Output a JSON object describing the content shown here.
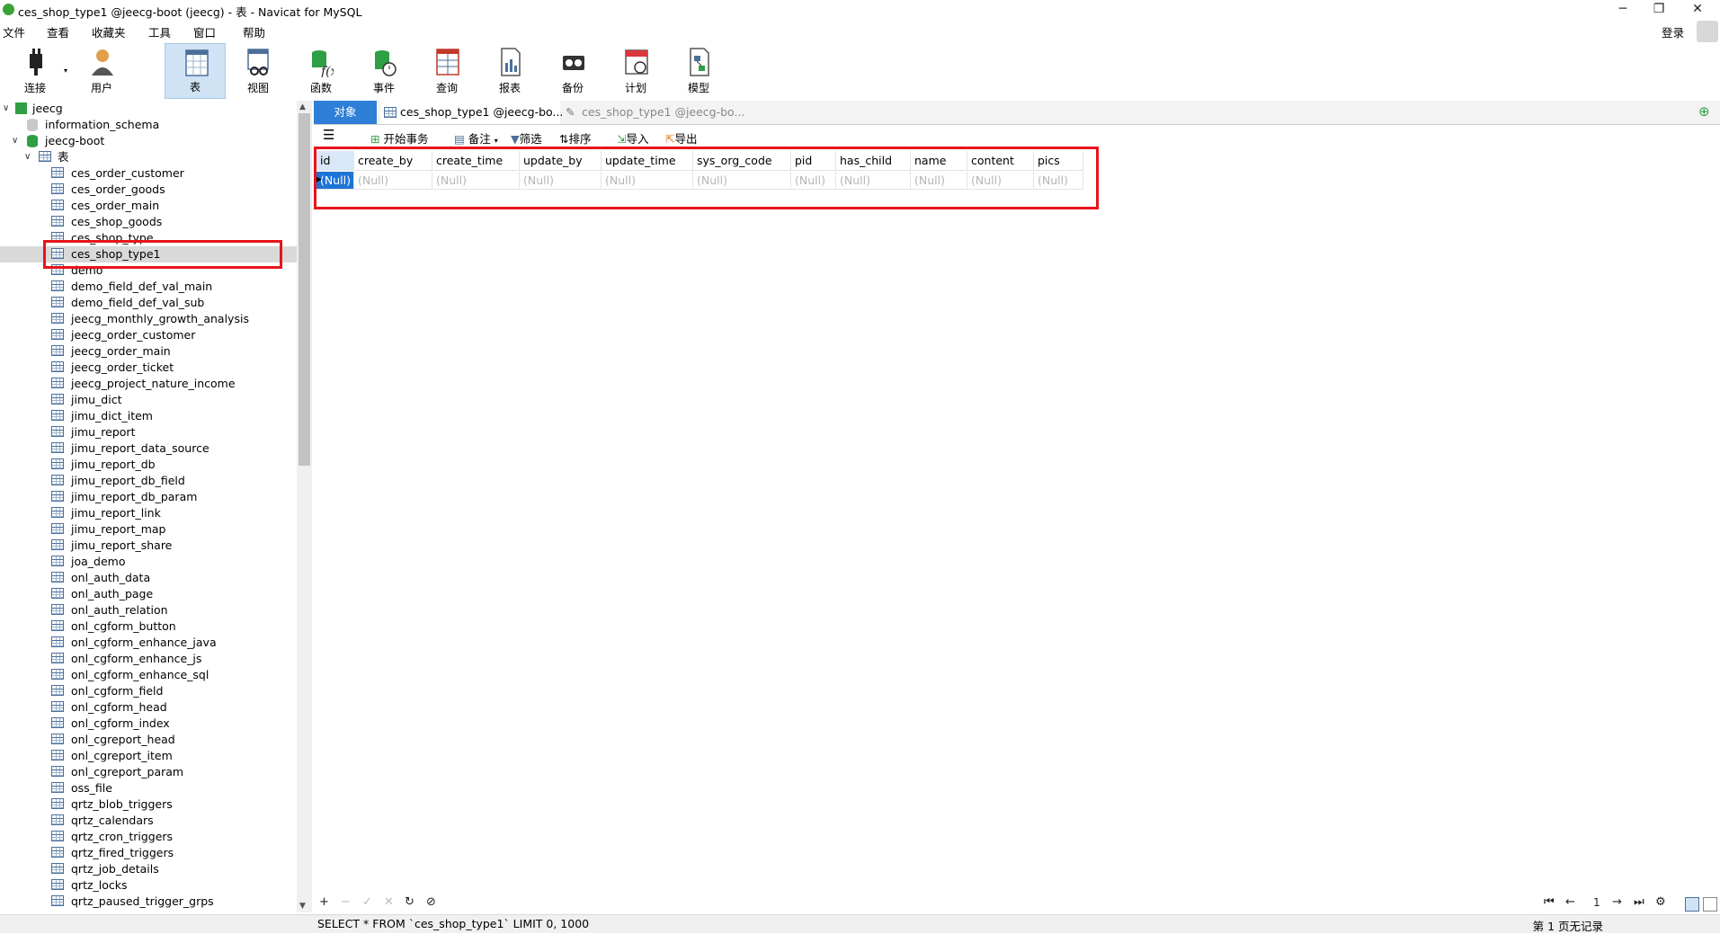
{
  "window": {
    "title": "ces_shop_type1 @jeecg-boot (jeecg) - 表 - Navicat for MySQL",
    "min": "─",
    "max": "❐",
    "close": "✕"
  },
  "menu": [
    "文件",
    "查看",
    "收藏夹",
    "工具",
    "窗口",
    "帮助"
  ],
  "login_label": "登录",
  "toolbar": [
    {
      "label": "连接",
      "icon": "plug-icon"
    },
    {
      "label": "用户",
      "icon": "user-icon"
    },
    {
      "label": "表",
      "icon": "table-icon"
    },
    {
      "label": "视图",
      "icon": "view-icon"
    },
    {
      "label": "函数",
      "icon": "function-icon"
    },
    {
      "label": "事件",
      "icon": "event-icon"
    },
    {
      "label": "查询",
      "icon": "query-icon"
    },
    {
      "label": "报表",
      "icon": "report-icon"
    },
    {
      "label": "备份",
      "icon": "backup-icon"
    },
    {
      "label": "计划",
      "icon": "schedule-icon"
    },
    {
      "label": "模型",
      "icon": "model-icon"
    }
  ],
  "tree": {
    "connection": "jeecg",
    "databases": [
      "information_schema",
      "jeecg-boot"
    ],
    "tables_folder": "表",
    "selected": "ces_shop_type1",
    "tables": [
      "ces_order_customer",
      "ces_order_goods",
      "ces_order_main",
      "ces_shop_goods",
      "ces_shop_type",
      "ces_shop_type1",
      "demo",
      "demo_field_def_val_main",
      "demo_field_def_val_sub",
      "jeecg_monthly_growth_analysis",
      "jeecg_order_customer",
      "jeecg_order_main",
      "jeecg_order_ticket",
      "jeecg_project_nature_income",
      "jimu_dict",
      "jimu_dict_item",
      "jimu_report",
      "jimu_report_data_source",
      "jimu_report_db",
      "jimu_report_db_field",
      "jimu_report_db_param",
      "jimu_report_link",
      "jimu_report_map",
      "jimu_report_share",
      "joa_demo",
      "onl_auth_data",
      "onl_auth_page",
      "onl_auth_relation",
      "onl_cgform_button",
      "onl_cgform_enhance_java",
      "onl_cgform_enhance_js",
      "onl_cgform_enhance_sql",
      "onl_cgform_field",
      "onl_cgform_head",
      "onl_cgform_index",
      "onl_cgreport_head",
      "onl_cgreport_item",
      "onl_cgreport_param",
      "oss_file",
      "qrtz_blob_triggers",
      "qrtz_calendars",
      "qrtz_cron_triggers",
      "qrtz_fired_triggers",
      "qrtz_job_details",
      "qrtz_locks",
      "qrtz_paused_trigger_grps"
    ]
  },
  "tabs": {
    "objects": "对象",
    "tab1": "ces_shop_type1 @jeecg-bo...",
    "tab2": "ces_shop_type1 @jeecg-bo..."
  },
  "object_toolbar": {
    "begin_tx": "开始事务",
    "memo": "备注",
    "filter": "筛选",
    "sort": "排序",
    "import": "导入",
    "export": "导出"
  },
  "grid": {
    "columns": [
      "id",
      "create_by",
      "create_time",
      "update_by",
      "update_time",
      "sys_org_code",
      "pid",
      "has_child",
      "name",
      "content",
      "pics"
    ],
    "row": [
      "(Null)",
      "(Null)",
      "(Null)",
      "(Null)",
      "(Null)",
      "(Null)",
      "(Null)",
      "(Null)",
      "(Null)",
      "(Null)",
      "(Null)"
    ]
  },
  "bottom": {
    "add": "+",
    "remove": "−",
    "apply": "✓",
    "cancel": "✕",
    "refresh": "↻",
    "stop": "⊘",
    "first": "⏮",
    "prev": "←",
    "page": "1",
    "next": "→",
    "last": "⏭",
    "settings": "⚙"
  },
  "status": {
    "sql": "SELECT * FROM `ces_shop_type1` LIMIT 0, 1000",
    "records": "第 1 页无记录"
  },
  "colors": {
    "accent": "#2f7fd8",
    "highlight": "#e8141c",
    "db_green": "#2f9e44"
  }
}
